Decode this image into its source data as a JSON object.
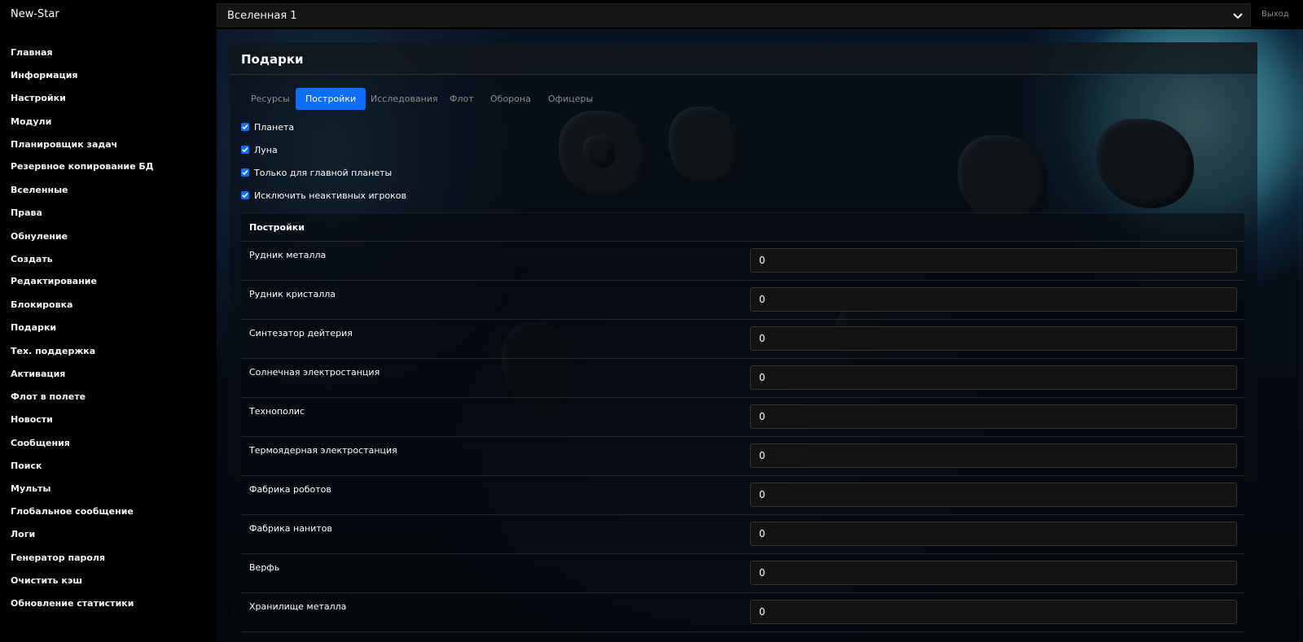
{
  "header": {
    "brand": "New-Star",
    "universe_select": "Вселенная 1",
    "logout": "Выход"
  },
  "sidebar": {
    "items": [
      "Главная",
      "Информация",
      "Настройки",
      "Модули",
      "Планировщик задач",
      "Резервное копирование БД",
      "Вселенные",
      "Права",
      "Обнуление",
      "Создать",
      "Редактирование",
      "Блокировка",
      "Подарки",
      "Тех. поддержка",
      "Активация",
      "Флот в полете",
      "Новости",
      "Сообщения",
      "Поиск",
      "Мульты",
      "Глобальное сообщение",
      "Логи",
      "Генератор пароля",
      "Очистить кэш",
      "Обновление статистики"
    ]
  },
  "panel": {
    "title": "Подарки",
    "tabs": [
      "Ресурсы",
      "Постройки",
      "Исследования",
      "Флот",
      "Оборона",
      "Офицеры"
    ],
    "active_tab": "Постройки",
    "checkboxes": [
      {
        "label": "Планета",
        "checked": true
      },
      {
        "label": "Луна",
        "checked": true
      },
      {
        "label": "Только для главной планеты",
        "checked": true
      },
      {
        "label": "Исключить неактивных игроков",
        "checked": true
      }
    ],
    "table_title": "Постройки",
    "rows": [
      {
        "label": "Рудник металла",
        "value": "0"
      },
      {
        "label": "Рудник кристалла",
        "value": "0"
      },
      {
        "label": "Синтезатор дейтерия",
        "value": "0"
      },
      {
        "label": "Солнечная электростанция",
        "value": "0"
      },
      {
        "label": "Технополис",
        "value": "0"
      },
      {
        "label": "Термоядерная электростанция",
        "value": "0"
      },
      {
        "label": "Фабрика роботов",
        "value": "0"
      },
      {
        "label": "Фабрика нанитов",
        "value": "0"
      },
      {
        "label": "Верфь",
        "value": "0"
      },
      {
        "label": "Хранилище металла",
        "value": "0"
      }
    ]
  },
  "colors": {
    "accent": "#0d6efd",
    "background": "#000000"
  }
}
